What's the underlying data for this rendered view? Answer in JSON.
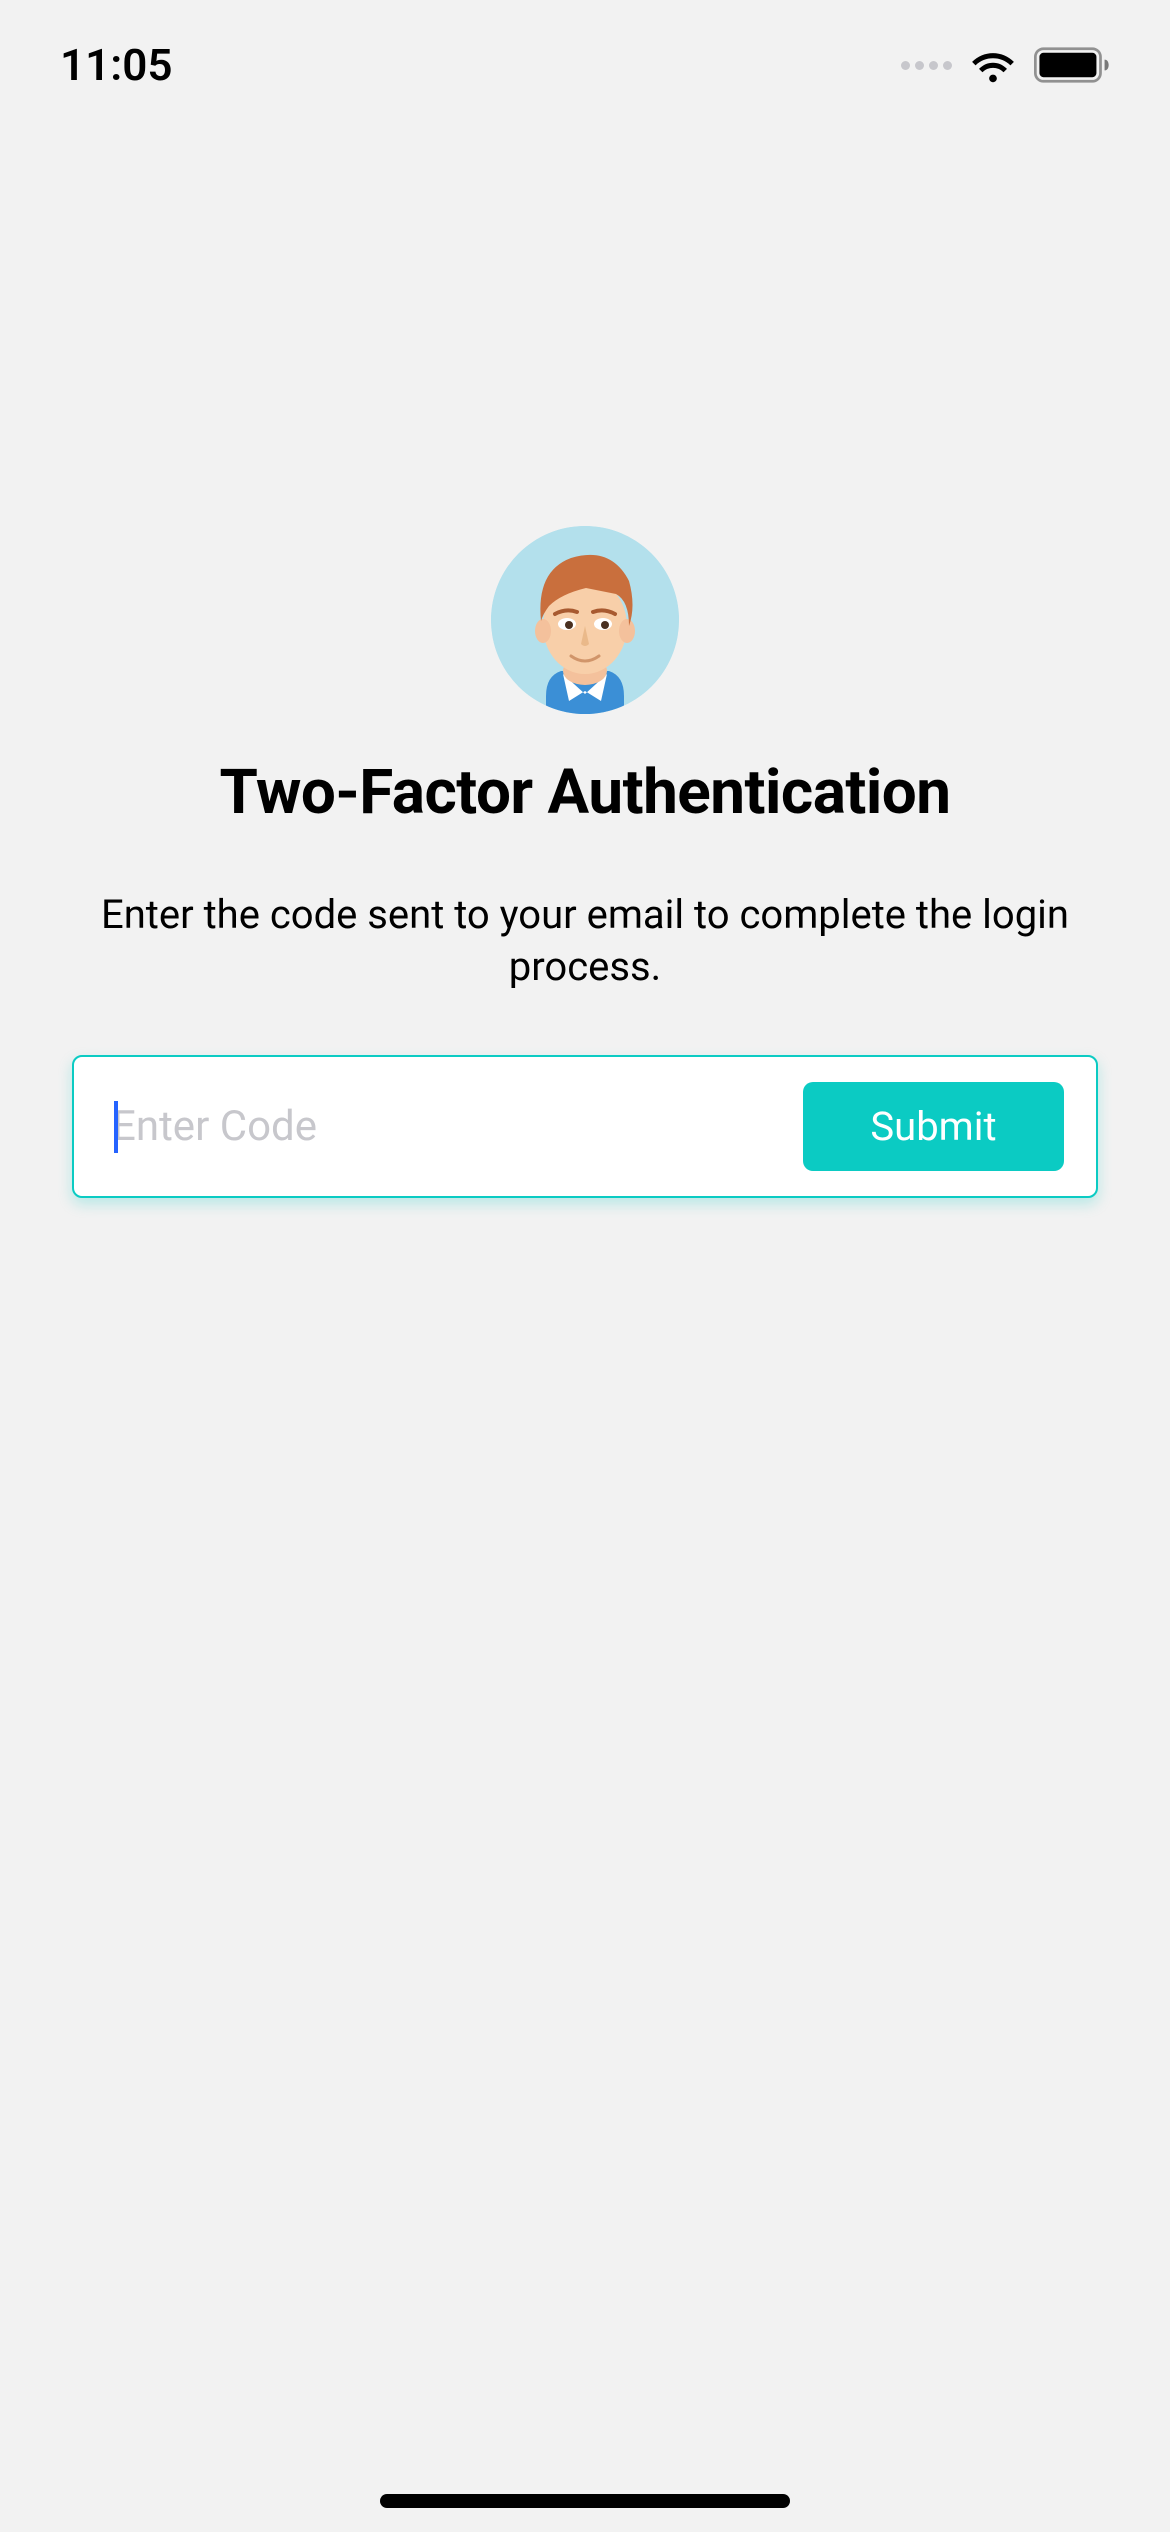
{
  "statusBar": {
    "time": "11:05"
  },
  "main": {
    "title": "Two-Factor Authentication",
    "subtitle": "Enter the code sent to your email to complete the login process.",
    "codeInput": {
      "placeholder": "Enter Code",
      "value": ""
    },
    "submitLabel": "Submit"
  },
  "icons": {
    "avatar": "person-avatar",
    "wifi": "wifi-icon",
    "battery": "battery-icon",
    "signal": "cellular-signal-icon"
  },
  "colors": {
    "background": "#f2f2f2",
    "accent": "#0bcbc3",
    "caret": "#2563ff",
    "placeholder": "#c7c7cc"
  }
}
